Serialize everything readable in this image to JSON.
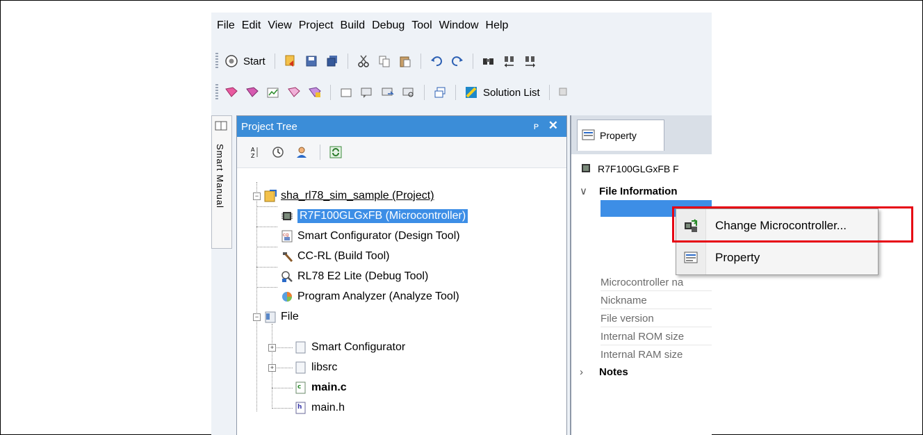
{
  "menu": [
    "File",
    "Edit",
    "View",
    "Project",
    "Build",
    "Debug",
    "Tool",
    "Window",
    "Help"
  ],
  "toolbar1": {
    "start_label": "Start"
  },
  "toolbar2": {
    "solution_list_label": "Solution List"
  },
  "smart_manual": {
    "label": "Smart Manual"
  },
  "project_tree": {
    "title": "Project Tree",
    "pin": "ᵖ",
    "close": "✕",
    "items": [
      {
        "label": "sha_rl78_sim_sample (Project)"
      },
      {
        "label": "R7F100GLGxFB (Microcontroller)"
      },
      {
        "label": "Smart Configurator (Design Tool)"
      },
      {
        "label": "CC-RL (Build Tool)"
      },
      {
        "label": "RL78 E2 Lite (Debug Tool)"
      },
      {
        "label": "Program Analyzer (Analyze Tool)"
      },
      {
        "label": "File"
      },
      {
        "label": "Smart Configurator"
      },
      {
        "label": "libsrc"
      },
      {
        "label": "main.c"
      },
      {
        "label": "main.h"
      }
    ]
  },
  "property_panel": {
    "tab": "Property",
    "device": "R7F100GLGxFB F",
    "categories": [
      "File Information",
      "Notes"
    ],
    "rows": [
      "Microcontroller na",
      "Nickname",
      "File version",
      "Internal ROM size",
      "Internal RAM size"
    ]
  },
  "context_menu": {
    "items": [
      {
        "label": "Change Microcontroller..."
      },
      {
        "label": "Property"
      }
    ]
  },
  "colors": {
    "selection": "#3d8ee6",
    "highlight_box": "#e60012",
    "title_bar": "#3b8dd8"
  }
}
